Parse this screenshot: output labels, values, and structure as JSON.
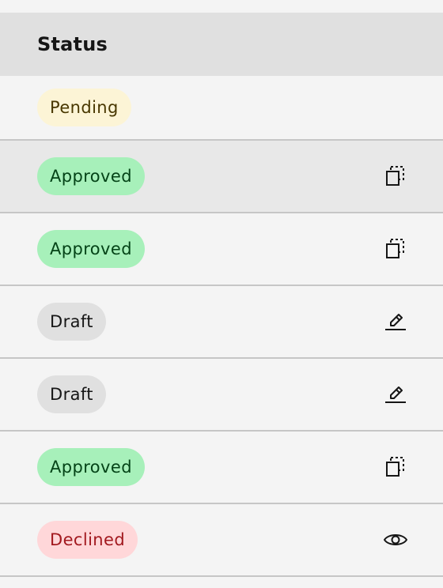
{
  "header": {
    "status_label": "Status"
  },
  "rows": [
    {
      "status": "Pending",
      "variant": "pending",
      "action": ""
    },
    {
      "status": "Approved",
      "variant": "approved",
      "action": "copy-icon"
    },
    {
      "status": "Approved",
      "variant": "approved",
      "action": "copy-icon"
    },
    {
      "status": "Draft",
      "variant": "draft",
      "action": "edit-icon"
    },
    {
      "status": "Draft",
      "variant": "draft",
      "action": "edit-icon"
    },
    {
      "status": "Approved",
      "variant": "approved",
      "action": "copy-icon"
    },
    {
      "status": "Declined",
      "variant": "declined",
      "action": "view-icon"
    }
  ],
  "colors": {
    "pending_bg": "#fcf4d6",
    "approved_bg": "#a7f0ba",
    "draft_bg": "#e0e0e0",
    "declined_bg": "#ffd7d9"
  }
}
